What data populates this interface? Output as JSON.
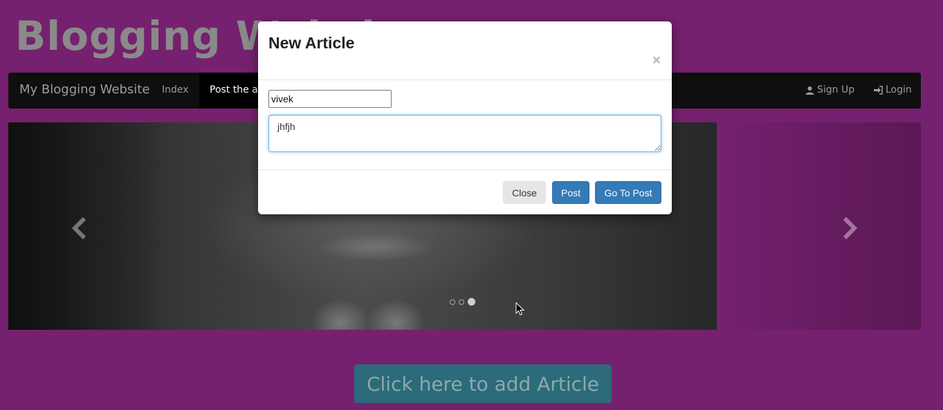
{
  "site": {
    "title": "Blogging Website"
  },
  "navbar": {
    "brand": "My Blogging Website",
    "links": [
      "Index",
      "Post the article"
    ],
    "signup_label": "Sign Up",
    "login_label": "Login",
    "background": "#0f0f0f"
  },
  "carousel": {
    "slide_count": 3,
    "active_index": 2,
    "prev_icon": "chevron-left-icon",
    "next_icon": "chevron-right-icon"
  },
  "add_article_button": {
    "label": "Click here to add Article",
    "color": "#2b6b7a"
  },
  "modal": {
    "title": "New Article",
    "close_symbol": "×",
    "title_input_value": "vivek",
    "body_value": "jhfjh",
    "buttons": {
      "close": "Close",
      "post": "Post",
      "go_to_post": "Go To Post"
    },
    "primary_color": "#337ab7"
  },
  "colors": {
    "page_background": "#75216f"
  }
}
